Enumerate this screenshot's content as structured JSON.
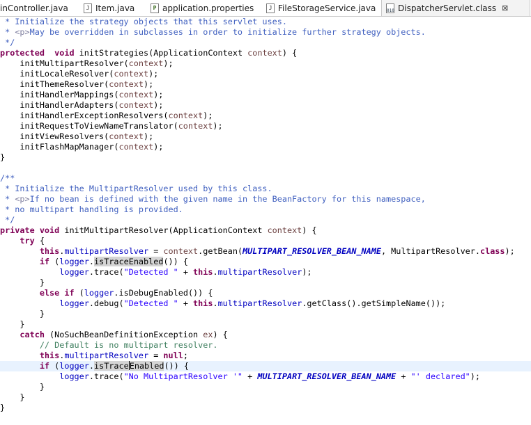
{
  "tabs": [
    {
      "label": "inController.java",
      "icon": "java-file-icon"
    },
    {
      "label": "Item.java",
      "icon": "java-file-icon"
    },
    {
      "label": "application.properties",
      "icon": "properties-file-icon"
    },
    {
      "label": "FileStorageService.java",
      "icon": "java-file-icon"
    },
    {
      "label": "DispatcherServlet.class",
      "icon": "class-file-icon",
      "active": true,
      "close": "⊠"
    }
  ],
  "code": [
    [
      [
        "jd",
        " * Initialize the strategy objects that this servlet uses."
      ]
    ],
    [
      [
        "jd",
        " * "
      ],
      [
        "jdtag",
        "<p>"
      ],
      [
        "jd",
        "May be overridden in subclasses in order to initialize further strategy objects."
      ]
    ],
    [
      [
        "jd",
        " */"
      ]
    ],
    [
      [
        "kw",
        "protected"
      ],
      [
        "",
        "  "
      ],
      [
        "kw",
        "void"
      ],
      [
        "",
        " initStrategies(ApplicationContext "
      ],
      [
        "var",
        "context"
      ],
      [
        "",
        ") {"
      ]
    ],
    [
      [
        "",
        "    initMultipartResolver("
      ],
      [
        "var",
        "context"
      ],
      [
        "",
        ");"
      ]
    ],
    [
      [
        "",
        "    initLocaleResolver("
      ],
      [
        "var",
        "context"
      ],
      [
        "",
        ");"
      ]
    ],
    [
      [
        "",
        "    initThemeResolver("
      ],
      [
        "var",
        "context"
      ],
      [
        "",
        ");"
      ]
    ],
    [
      [
        "",
        "    initHandlerMappings("
      ],
      [
        "var",
        "context"
      ],
      [
        "",
        ");"
      ]
    ],
    [
      [
        "",
        "    initHandlerAdapters("
      ],
      [
        "var",
        "context"
      ],
      [
        "",
        ");"
      ]
    ],
    [
      [
        "",
        "    initHandlerExceptionResolvers("
      ],
      [
        "var",
        "context"
      ],
      [
        "",
        ");"
      ]
    ],
    [
      [
        "",
        "    initRequestToViewNameTranslator("
      ],
      [
        "var",
        "context"
      ],
      [
        "",
        ");"
      ]
    ],
    [
      [
        "",
        "    initViewResolvers("
      ],
      [
        "var",
        "context"
      ],
      [
        "",
        ");"
      ]
    ],
    [
      [
        "",
        "    initFlashMapManager("
      ],
      [
        "var",
        "context"
      ],
      [
        "",
        ");"
      ]
    ],
    [
      [
        "",
        "}"
      ]
    ],
    [
      [
        "",
        ""
      ]
    ],
    [
      [
        "jd",
        "/**"
      ]
    ],
    [
      [
        "jd",
        " * Initialize the MultipartResolver used by this class."
      ]
    ],
    [
      [
        "jd",
        " * "
      ],
      [
        "jdtag",
        "<p>"
      ],
      [
        "jd",
        "If no bean is defined with the given name in the BeanFactory for this namespace,"
      ]
    ],
    [
      [
        "jd",
        " * no multipart handling is provided."
      ]
    ],
    [
      [
        "jd",
        " */"
      ]
    ],
    [
      [
        "kw",
        "private"
      ],
      [
        "",
        " "
      ],
      [
        "kw",
        "void"
      ],
      [
        "",
        " initMultipartResolver(ApplicationContext "
      ],
      [
        "var",
        "context"
      ],
      [
        "",
        ") {"
      ]
    ],
    [
      [
        "",
        "    "
      ],
      [
        "kw",
        "try"
      ],
      [
        "",
        " {"
      ]
    ],
    [
      [
        "",
        "        "
      ],
      [
        "kw",
        "this"
      ],
      [
        "",
        "."
      ],
      [
        "fld",
        "multipartResolver"
      ],
      [
        "",
        " = "
      ],
      [
        "var",
        "context"
      ],
      [
        "",
        ".getBean("
      ],
      [
        "cst",
        "MULTIPART_RESOLVER_BEAN_NAME"
      ],
      [
        "",
        ", MultipartResolver."
      ],
      [
        "kw",
        "class"
      ],
      [
        "",
        ");"
      ]
    ],
    [
      [
        "",
        "        "
      ],
      [
        "kw",
        "if"
      ],
      [
        "",
        " ("
      ],
      [
        "fld",
        "logger"
      ],
      [
        "",
        "."
      ],
      [
        "occ",
        "isTraceEnabled"
      ],
      [
        "",
        "()) {"
      ]
    ],
    [
      [
        "",
        "            "
      ],
      [
        "fld",
        "logger"
      ],
      [
        "",
        ".trace("
      ],
      [
        "str",
        "\"Detected \""
      ],
      [
        "",
        " + "
      ],
      [
        "kw",
        "this"
      ],
      [
        "",
        "."
      ],
      [
        "fld",
        "multipartResolver"
      ],
      [
        "",
        ");"
      ]
    ],
    [
      [
        "",
        "        }"
      ]
    ],
    [
      [
        "",
        "        "
      ],
      [
        "kw",
        "else"
      ],
      [
        "",
        " "
      ],
      [
        "kw",
        "if"
      ],
      [
        "",
        " ("
      ],
      [
        "fld",
        "logger"
      ],
      [
        "",
        ".isDebugEnabled()) {"
      ]
    ],
    [
      [
        "",
        "            "
      ],
      [
        "fld",
        "logger"
      ],
      [
        "",
        ".debug("
      ],
      [
        "str",
        "\"Detected \""
      ],
      [
        "",
        " + "
      ],
      [
        "kw",
        "this"
      ],
      [
        "",
        "."
      ],
      [
        "fld",
        "multipartResolver"
      ],
      [
        "",
        ".getClass().getSimpleName());"
      ]
    ],
    [
      [
        "",
        "        }"
      ]
    ],
    [
      [
        "",
        "    }"
      ]
    ],
    [
      [
        "",
        "    "
      ],
      [
        "kw",
        "catch"
      ],
      [
        "",
        " (NoSuchBeanDefinitionException "
      ],
      [
        "var",
        "ex"
      ],
      [
        "",
        ") {"
      ]
    ],
    [
      [
        "",
        "        "
      ],
      [
        "cm",
        "// Default is no multipart resolver."
      ]
    ],
    [
      [
        "",
        "        "
      ],
      [
        "kw",
        "this"
      ],
      [
        "",
        "."
      ],
      [
        "fld",
        "multipartResolver"
      ],
      [
        "",
        " = "
      ],
      [
        "kw",
        "null"
      ],
      [
        "",
        ";"
      ]
    ],
    [
      [
        "",
        "        "
      ],
      [
        "kw",
        "if"
      ],
      [
        "",
        " ("
      ],
      [
        "fld",
        "logger"
      ],
      [
        "",
        "."
      ],
      [
        "occ",
        "isTrace"
      ],
      [
        "caret",
        ""
      ],
      [
        "occ",
        "Enabled"
      ],
      [
        "",
        "()) {"
      ]
    ],
    [
      [
        "",
        "            "
      ],
      [
        "fld",
        "logger"
      ],
      [
        "",
        ".trace("
      ],
      [
        "str",
        "\"No MultipartResolver '\""
      ],
      [
        "",
        " + "
      ],
      [
        "cst",
        "MULTIPART_RESOLVER_BEAN_NAME"
      ],
      [
        "",
        " + "
      ],
      [
        "str",
        "\"' declared\""
      ],
      [
        "",
        ");"
      ]
    ],
    [
      [
        "",
        "        }"
      ]
    ],
    [
      [
        "",
        "    }"
      ]
    ],
    [
      [
        "",
        "}"
      ]
    ]
  ],
  "current_line": 33
}
